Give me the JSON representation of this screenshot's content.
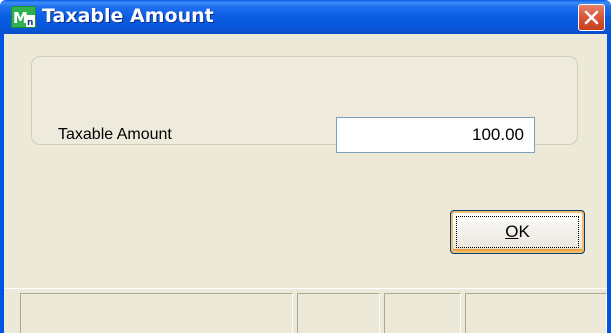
{
  "window": {
    "title": "Taxable Amount",
    "icon": "mas-app-icon",
    "close_icon": "close-icon",
    "colors": {
      "titlebar": "#0054e3",
      "client": "#ece9d8",
      "close_button": "#d9573a"
    }
  },
  "form": {
    "field_label": "Taxable Amount",
    "field_value": "100.00"
  },
  "buttons": {
    "ok_mnemonic": "O",
    "ok_rest": "K"
  },
  "statusbar": {
    "panels": [
      "",
      "",
      "",
      ""
    ]
  }
}
